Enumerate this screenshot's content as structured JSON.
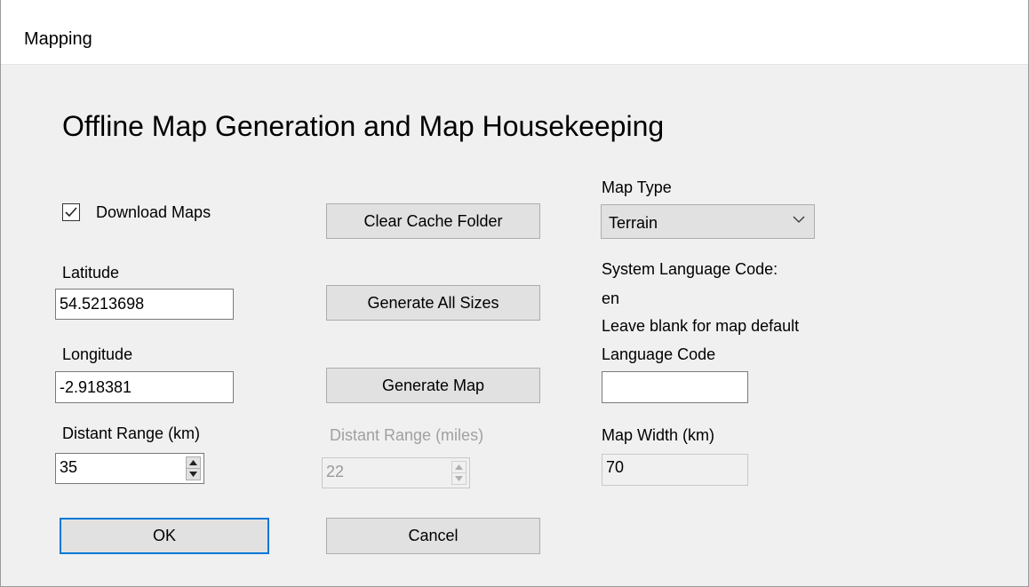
{
  "window": {
    "title": "Mapping",
    "heading": "Offline Map Generation and Map Housekeeping"
  },
  "download": {
    "label": "Download Maps",
    "checked": true
  },
  "latitude": {
    "label": "Latitude",
    "value": "54.5213698"
  },
  "longitude": {
    "label": "Longitude",
    "value": "-2.918381"
  },
  "distant_range_km": {
    "label": "Distant Range (km)",
    "value": "35"
  },
  "distant_range_miles": {
    "label": "Distant Range (miles)",
    "value": "22",
    "enabled": false
  },
  "buttons": {
    "clear_cache": "Clear Cache Folder",
    "generate_all": "Generate All Sizes",
    "generate_map": "Generate Map",
    "ok": "OK",
    "cancel": "Cancel"
  },
  "map_type": {
    "label": "Map Type",
    "selected": "Terrain"
  },
  "language": {
    "system_label": "System Language Code:",
    "system_value": "en",
    "hint": "Leave blank for map default",
    "code_label": "Language Code",
    "code_value": ""
  },
  "map_width": {
    "label": "Map Width (km)",
    "value": "70"
  },
  "colors": {
    "accent": "#0078d7",
    "dialog_bg": "#f0f0f0",
    "button_bg": "#e1e1e1",
    "disabled_text": "#a0a0a0"
  },
  "icons": {
    "checkbox": "checkmark-icon",
    "combo": "chevron-down-icon",
    "spinner_up": "triangle-up-icon",
    "spinner_down": "triangle-down-icon"
  }
}
